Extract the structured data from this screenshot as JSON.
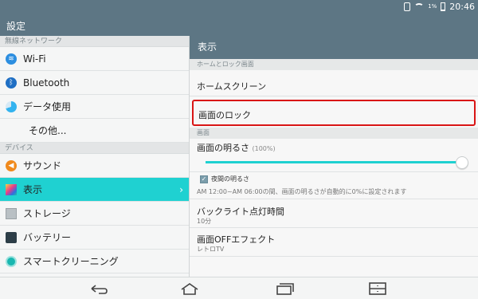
{
  "statusbar": {
    "battery": "1%",
    "time": "20:46"
  },
  "actionbar": {
    "title": "設定"
  },
  "left": {
    "section1": "無線ネットワーク",
    "wifi": "Wi-Fi",
    "bluetooth": "Bluetooth",
    "data_usage": "データ使用",
    "other": "その他...",
    "section2": "デバイス",
    "sound": "サウンド",
    "display": "表示",
    "storage": "ストレージ",
    "battery": "バッテリー",
    "smart_cleaning": "スマートクリーニング"
  },
  "right": {
    "header": "表示",
    "section_home_lock": "ホームとロック画面",
    "home_screen": "ホームスクリーン",
    "lock_screen": "画面のロック",
    "section_screen": "画面",
    "brightness_label": "画面の明るさ",
    "brightness_pct": "(100%)",
    "brightness_value": 1.0,
    "night_label": "夜間の明るさ",
    "night_desc": "AM 12:00~AM 06:00の間、画面の明るさが自動的に0%に設定されます",
    "backlight_label": "バックライト点灯時間",
    "backlight_value": "10分",
    "off_effect_label": "画面OFFエフェクト",
    "off_effect_value": "レトロTV"
  },
  "colors": {
    "accent": "#1fd1d1",
    "header": "#5d7684",
    "highlight": "#d91515"
  }
}
